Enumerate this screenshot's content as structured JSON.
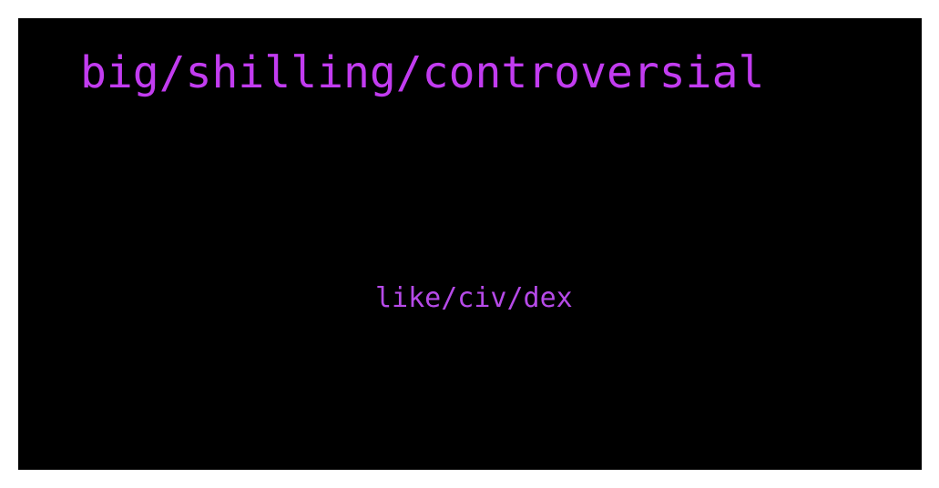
{
  "slide": {
    "headline": "big/shilling/controversial",
    "subline": "like/civ/dex"
  },
  "colors": {
    "background": "#000000",
    "frame": "#ffffff",
    "headline_text": "#c23cf0",
    "subline_text": "#b64ae8"
  }
}
